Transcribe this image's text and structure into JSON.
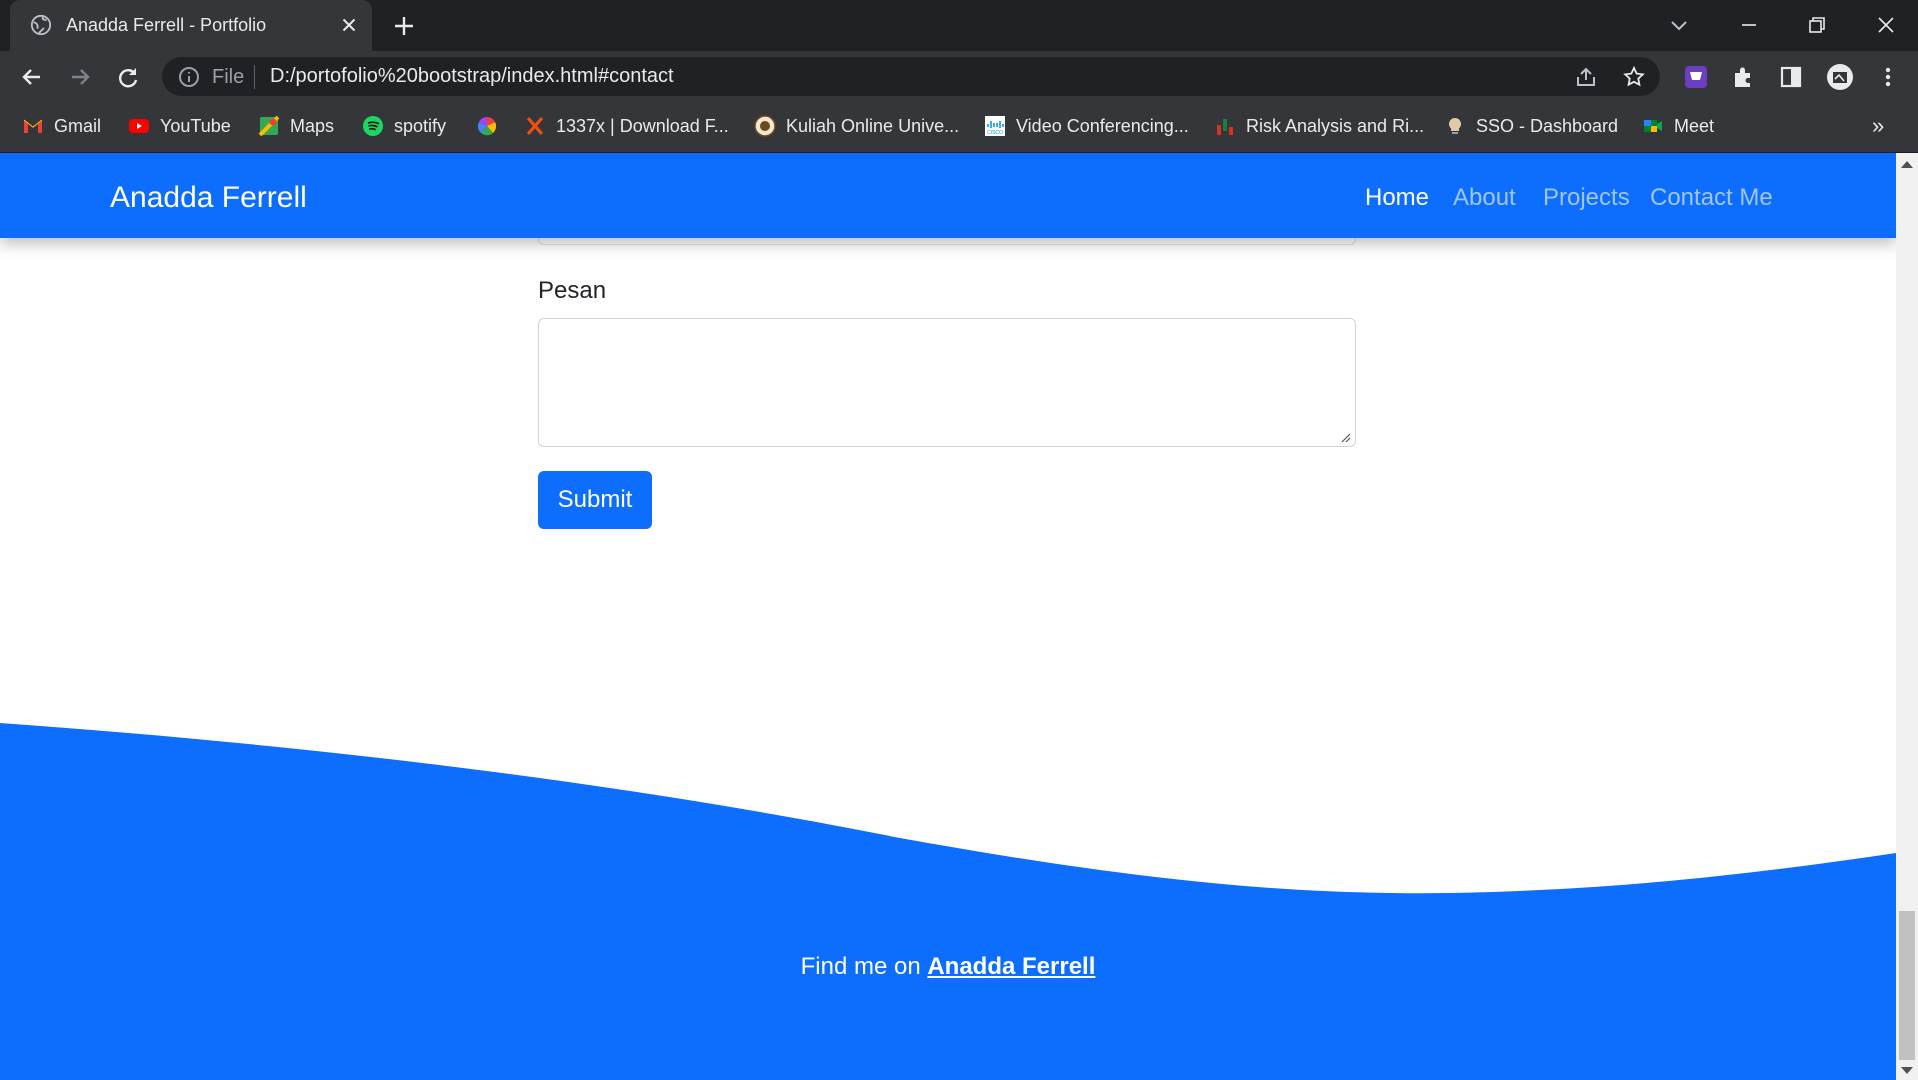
{
  "browser": {
    "tab": {
      "title": "Anadda Ferrell - Portfolio",
      "favicon": "globe-icon",
      "close": "close-icon"
    },
    "new_tab": "plus-icon",
    "window_controls": [
      "tab-search-icon",
      "minimize-icon",
      "restore-icon",
      "close-icon"
    ],
    "address": {
      "scheme_label": "File",
      "url": "D:/portofolio%20bootstrap/index.html#contact"
    },
    "bookmarks": [
      {
        "label": "Gmail",
        "icon": "gmail-icon"
      },
      {
        "label": "YouTube",
        "icon": "youtube-icon"
      },
      {
        "label": "Maps",
        "icon": "maps-icon"
      },
      {
        "label": "spotify",
        "icon": "spotify-icon"
      },
      {
        "label": "",
        "icon": "pinwheel-icon"
      },
      {
        "label": "1337x | Download F...",
        "icon": "x-icon"
      },
      {
        "label": "Kuliah Online Unive...",
        "icon": "university-seal-icon"
      },
      {
        "label": "Video Conferencing...",
        "icon": "cisco-icon"
      },
      {
        "label": "Risk Analysis and Ri...",
        "icon": "chart-icon"
      },
      {
        "label": "SSO - Dashboard",
        "icon": "bulb-icon"
      },
      {
        "label": "Meet",
        "icon": "meet-icon"
      }
    ],
    "more_bookmarks": "»"
  },
  "site": {
    "brand": "Anadda Ferrell",
    "nav": [
      {
        "label": "Home",
        "active": true
      },
      {
        "label": "About",
        "active": false
      },
      {
        "label": "Projects",
        "active": false
      },
      {
        "label": "Contact Me",
        "active": false
      }
    ],
    "contact": {
      "message_label": "Pesan",
      "message_value": "",
      "submit_label": "Submit"
    },
    "footer": {
      "prefix": "Find me on ",
      "link_label": "Anadda Ferrell"
    }
  },
  "colors": {
    "primary": "#0d6efd",
    "chrome_dark": "#202124",
    "chrome_toolbar": "#35363a"
  }
}
